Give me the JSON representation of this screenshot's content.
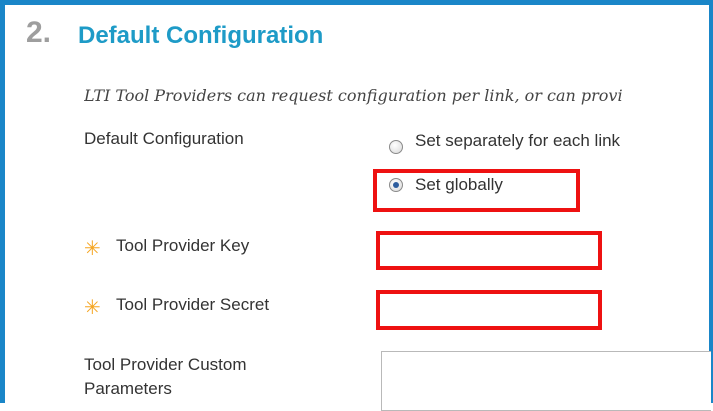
{
  "section": {
    "number": "2.",
    "title": "Default Configuration",
    "instructions": "LTI Tool Providers can request configuration per link, or can provi"
  },
  "default_configuration": {
    "label": "Default Configuration",
    "options": [
      {
        "label": "Set separately for each link",
        "checked": false
      },
      {
        "label": "Set globally",
        "checked": true
      }
    ]
  },
  "fields": {
    "required_icon": "asterisk-icon",
    "key": {
      "label": "Tool Provider Key",
      "value": "",
      "required": true
    },
    "secret": {
      "label": "Tool Provider Secret",
      "value": "",
      "required": true
    },
    "custom_parameters": {
      "label": "Tool Provider Custom Parameters",
      "value": ""
    }
  },
  "colors": {
    "accent": "#1e9bc7",
    "frame": "#1a86c8",
    "highlight": "#ee1111",
    "required": "#f5a623"
  }
}
